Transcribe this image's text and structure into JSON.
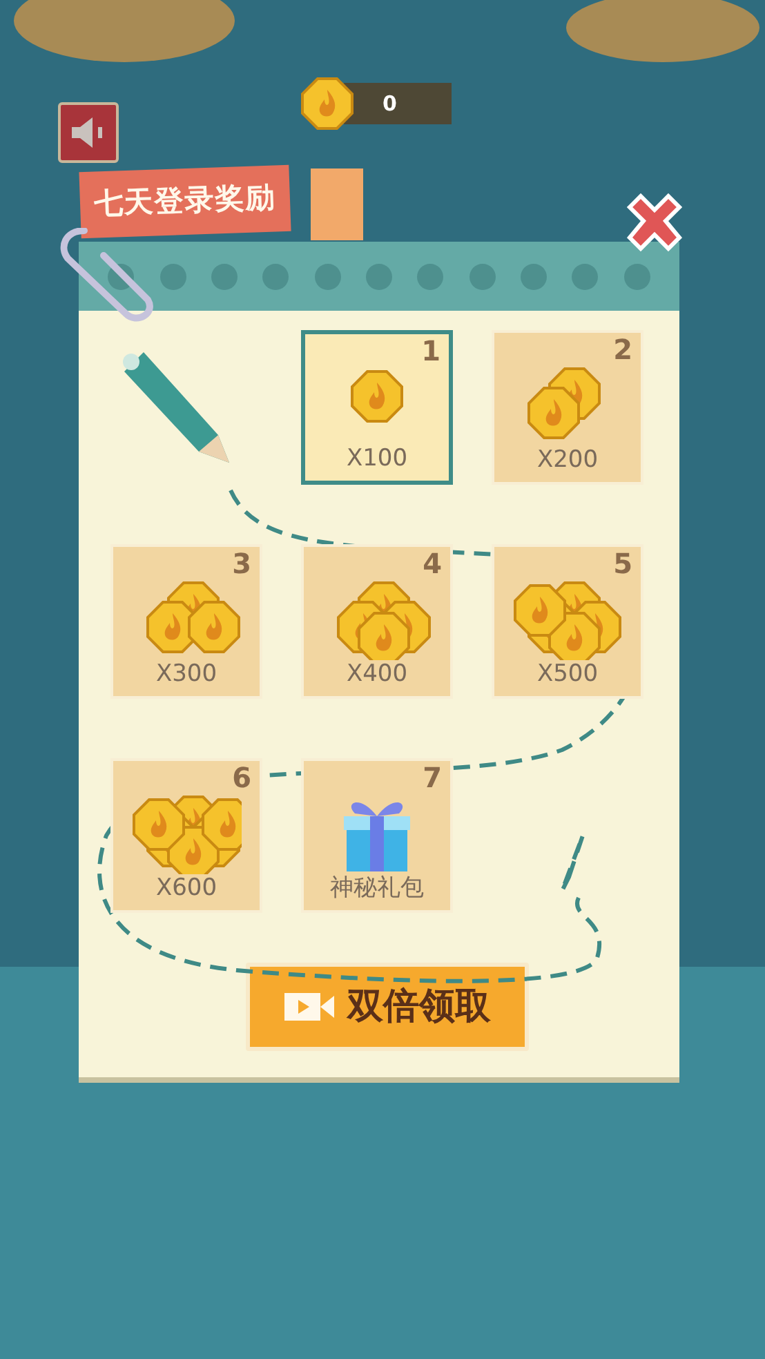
{
  "coin_counter": {
    "value": "0"
  },
  "sound_button": {
    "muted": false
  },
  "title": "七天登录奖励",
  "days": [
    {
      "day": "1",
      "kind": "coins",
      "reward": "X100",
      "selected": true
    },
    {
      "day": "2",
      "kind": "coins",
      "reward": "X200",
      "selected": false
    },
    {
      "day": "3",
      "kind": "coins",
      "reward": "X300",
      "selected": false
    },
    {
      "day": "4",
      "kind": "coins",
      "reward": "X400",
      "selected": false
    },
    {
      "day": "5",
      "kind": "coins",
      "reward": "X500",
      "selected": false
    },
    {
      "day": "6",
      "kind": "coins",
      "reward": "X600",
      "selected": false
    },
    {
      "day": "7",
      "kind": "gift",
      "reward": "神秘礼包",
      "selected": false
    }
  ],
  "claim_button": {
    "label": "双倍领取"
  }
}
